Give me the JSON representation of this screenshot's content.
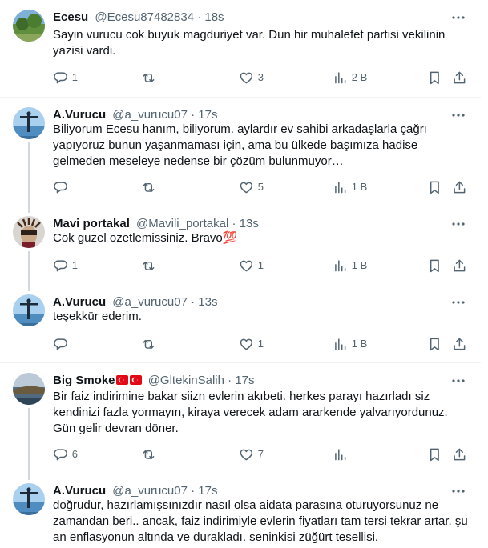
{
  "tweets": [
    {
      "name": "Ecesu",
      "handle": "@Ecesu87482834",
      "dot": "·",
      "time": "18s",
      "text": "Sayin vurucu cok buyuk magduriyet var. Dun hir muhalefet partisi vekilinin yazisi vardi.",
      "replies": "1",
      "retweets": "",
      "likes": "3",
      "views": "2 B",
      "avatar": "landscape-photo"
    },
    {
      "name": "A.Vurucu",
      "handle": "@a_vurucu07",
      "dot": "·",
      "time": "17s",
      "text": "Biliyorum Ecesu hanım, biliyorum. aylardır ev sahibi arkadaşlarla çağrı yapıyoruz bunun yaşanmaması için, ama bu ülkede başımıza hadise gelmeden meseleye nedense bir çözüm bulunmuyor…",
      "replies": "",
      "retweets": "",
      "likes": "5",
      "views": "1 B",
      "avatar": "person-on-lake"
    },
    {
      "name": "Mavi portakal",
      "handle": "@Mavili_portakal",
      "dot": "·",
      "time": "13s",
      "text": "Cok guzel ozetlemissiniz. Bravo💯",
      "replies": "1",
      "retweets": "",
      "likes": "1",
      "views": "1 B",
      "avatar": "carnival-mask"
    },
    {
      "name": "A.Vurucu",
      "handle": "@a_vurucu07",
      "dot": "·",
      "time": "13s",
      "text": "teşekkür ederim.",
      "replies": "",
      "retweets": "",
      "likes": "1",
      "views": "1 B",
      "avatar": "person-on-lake"
    },
    {
      "name": "Big Smoke",
      "handle": "@GltekinSalih",
      "dot": "·",
      "time": "17s",
      "text": "Bir faiz indirimine bakar siizn evlerin akıbeti. herkes parayı hazırladı siz kendinizi fazla yormayın, kiraya verecek adam ararkende yalvarıyordunuz. Gün gelir devran döner.",
      "replies": "6",
      "retweets": "",
      "likes": "7",
      "views": "",
      "avatar": "lake-photo"
    },
    {
      "name": "A.Vurucu",
      "handle": "@a_vurucu07",
      "dot": "·",
      "time": "17s",
      "text": "doğrudur, hazırlamışsınızdır nasıl olsa aidata parasına oturuyorsunuz ne zamandan beri.. ancak, faiz indirimiyle evlerin fiyatları tam tersi tekrar artar. şu an enflasyonun altında ve durakladı. seninkisi züğürt tesellisi.",
      "replies": "",
      "retweets": "",
      "likes": "",
      "views": "",
      "avatar": "person-on-lake"
    }
  ],
  "flags": [
    "turkey-flag",
    "turkey-flag"
  ],
  "colors": {
    "text": "#0f1419",
    "muted": "#536471",
    "divider": "#eff3f4",
    "thread": "#cfd9de"
  }
}
